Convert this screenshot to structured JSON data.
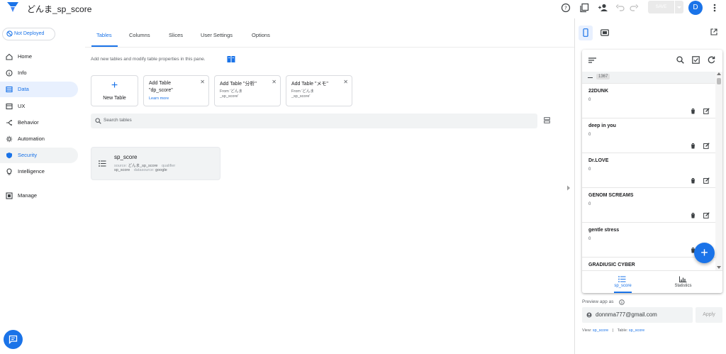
{
  "app": {
    "title": "どんま_sp_score",
    "save_label": "SAVE",
    "avatar_letter": "D"
  },
  "sidebar": {
    "deploy_status": "Not Deployed",
    "items": [
      {
        "label": "Home",
        "icon": "home-icon"
      },
      {
        "label": "Info",
        "icon": "info-icon"
      },
      {
        "label": "Data",
        "icon": "data-icon"
      },
      {
        "label": "UX",
        "icon": "ux-icon"
      },
      {
        "label": "Behavior",
        "icon": "behavior-icon"
      },
      {
        "label": "Automation",
        "icon": "automation-icon"
      },
      {
        "label": "Security",
        "icon": "shield-icon"
      },
      {
        "label": "Intelligence",
        "icon": "lightbulb-icon"
      },
      {
        "label": "Manage",
        "icon": "manage-icon"
      }
    ]
  },
  "tabs": [
    "Tables",
    "Columns",
    "Slices",
    "User Settings",
    "Options"
  ],
  "helper_text": "Add new tables and modify table properties in this pane.",
  "add_cards": {
    "new_table": "New Table",
    "dp": {
      "title": "Add Table \"dp_score\"",
      "link": "Learn more"
    },
    "analysis": {
      "title": "Add Table \"分析\"",
      "sub": "From 'どんま _sp_score'"
    },
    "memo": {
      "title": "Add Table \"メモ\"",
      "sub": "From 'どんま _sp_score'"
    }
  },
  "search": {
    "placeholder": "Search tables"
  },
  "table_card": {
    "name": "sp_score",
    "source_label": "source:",
    "source_value": "どんま_sp_score",
    "qualifier_label": "qualifier",
    "qualifier_value": "sp_score",
    "datasource_label": "datasource:",
    "datasource_value": "google"
  },
  "preview": {
    "group_header": "1367",
    "rows": [
      {
        "name": "22DUNK",
        "value": "0"
      },
      {
        "name": "deep in you",
        "value": "0"
      },
      {
        "name": "Dr.LOVE",
        "value": "0"
      },
      {
        "name": "GENOM SCREAMS",
        "value": "0"
      },
      {
        "name": "gentle stress",
        "value": "0"
      },
      {
        "name": "GRADIUSIC CYBER",
        "value": ""
      }
    ],
    "bottom_nav": [
      {
        "label": "sp_score",
        "icon": "list-icon",
        "active": true
      },
      {
        "label": "Statistics",
        "icon": "chart-icon",
        "active": false
      }
    ],
    "preview_as_label": "Preview app as",
    "email": "donnma777@gmail.com",
    "apply_label": "Apply",
    "view_label": "View:",
    "view_value": "sp_score",
    "separator": "|",
    "table_label": "Table:",
    "table_value": "sp_score"
  },
  "colors": {
    "accent": "#1a73e8",
    "active_bg": "#e8f0fe"
  }
}
